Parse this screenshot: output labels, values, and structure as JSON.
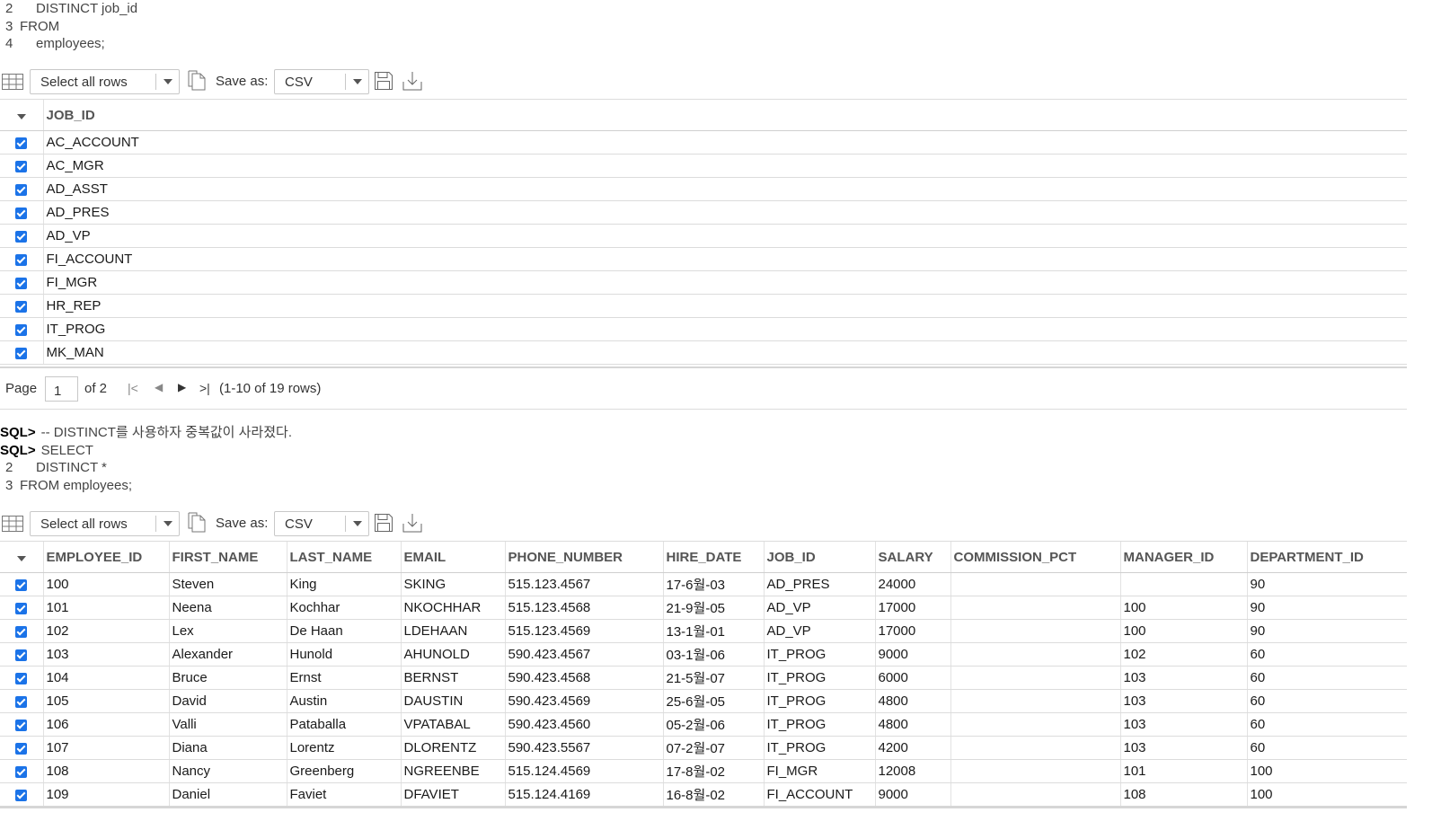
{
  "query1": {
    "lines": [
      {
        "num": "2",
        "text": "DISTINCT job_id",
        "indent": true
      },
      {
        "num": "3",
        "text": "FROM",
        "indent": false
      },
      {
        "num": "4",
        "text": "employees;",
        "indent": true
      }
    ]
  },
  "toolbar": {
    "rows_select": "Select all rows",
    "save_as_label": "Save as:",
    "format_select": "CSV"
  },
  "grid1": {
    "columns": [
      "JOB_ID"
    ],
    "rows": [
      [
        "AC_ACCOUNT"
      ],
      [
        "AC_MGR"
      ],
      [
        "AD_ASST"
      ],
      [
        "AD_PRES"
      ],
      [
        "AD_VP"
      ],
      [
        "FI_ACCOUNT"
      ],
      [
        "FI_MGR"
      ],
      [
        "HR_REP"
      ],
      [
        "IT_PROG"
      ],
      [
        "MK_MAN"
      ]
    ]
  },
  "pager": {
    "page_label": "Page",
    "page_value": "1",
    "of_label": "of 2",
    "row_count": "(1-10 of 19 rows)"
  },
  "query2": {
    "prompt": "SQL>",
    "comment": "-- DISTINCT를 사용하자 중복값이 사라졌다.",
    "select": "SELECT",
    "lines": [
      {
        "num": "2",
        "text": "DISTINCT *",
        "indent": true
      },
      {
        "num": "3",
        "text": "FROM employees;",
        "indent": false
      }
    ]
  },
  "grid2": {
    "columns": [
      "EMPLOYEE_ID",
      "FIRST_NAME",
      "LAST_NAME",
      "EMAIL",
      "PHONE_NUMBER",
      "HIRE_DATE",
      "JOB_ID",
      "SALARY",
      "COMMISSION_PCT",
      "MANAGER_ID",
      "DEPARTMENT_ID"
    ],
    "rows": [
      [
        "100",
        "Steven",
        "King",
        "SKING",
        "515.123.4567",
        "17-6월-03",
        "AD_PRES",
        "24000",
        "",
        "",
        "90"
      ],
      [
        "101",
        "Neena",
        "Kochhar",
        "NKOCHHAR",
        "515.123.4568",
        "21-9월-05",
        "AD_VP",
        "17000",
        "",
        "100",
        "90"
      ],
      [
        "102",
        "Lex",
        "De Haan",
        "LDEHAAN",
        "515.123.4569",
        "13-1월-01",
        "AD_VP",
        "17000",
        "",
        "100",
        "90"
      ],
      [
        "103",
        "Alexander",
        "Hunold",
        "AHUNOLD",
        "590.423.4567",
        "03-1월-06",
        "IT_PROG",
        "9000",
        "",
        "102",
        "60"
      ],
      [
        "104",
        "Bruce",
        "Ernst",
        "BERNST",
        "590.423.4568",
        "21-5월-07",
        "IT_PROG",
        "6000",
        "",
        "103",
        "60"
      ],
      [
        "105",
        "David",
        "Austin",
        "DAUSTIN",
        "590.423.4569",
        "25-6월-05",
        "IT_PROG",
        "4800",
        "",
        "103",
        "60"
      ],
      [
        "106",
        "Valli",
        "Pataballa",
        "VPATABAL",
        "590.423.4560",
        "05-2월-06",
        "IT_PROG",
        "4800",
        "",
        "103",
        "60"
      ],
      [
        "107",
        "Diana",
        "Lorentz",
        "DLORENTZ",
        "590.423.5567",
        "07-2월-07",
        "IT_PROG",
        "4200",
        "",
        "103",
        "60"
      ],
      [
        "108",
        "Nancy",
        "Greenberg",
        "NGREENBE",
        "515.124.4569",
        "17-8월-02",
        "FI_MGR",
        "12008",
        "",
        "101",
        "100"
      ],
      [
        "109",
        "Daniel",
        "Faviet",
        "DFAVIET",
        "515.124.4169",
        "16-8월-02",
        "FI_ACCOUNT",
        "9000",
        "",
        "108",
        "100"
      ]
    ]
  }
}
